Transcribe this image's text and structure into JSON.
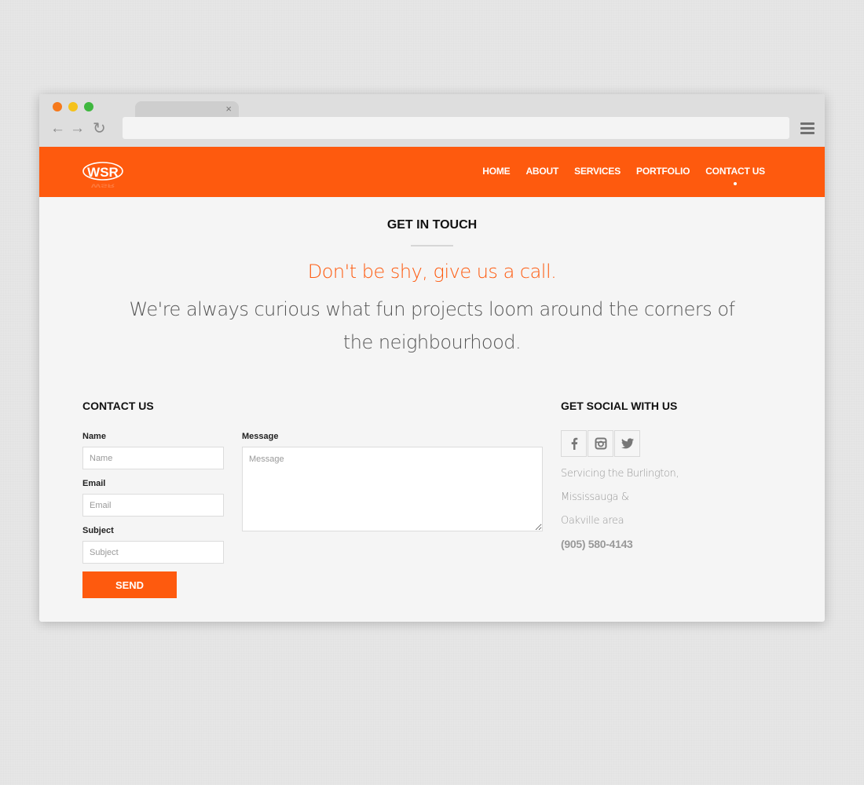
{
  "brand": {
    "logo_text": "WSR",
    "accent_color": "#fe5a0e"
  },
  "nav": {
    "items": [
      {
        "label": "HOME",
        "active": false
      },
      {
        "label": "ABOUT",
        "active": false
      },
      {
        "label": "SERVICES",
        "active": false
      },
      {
        "label": "PORTFOLIO",
        "active": false
      },
      {
        "label": "CONTACT US",
        "active": true
      }
    ]
  },
  "intro": {
    "title": "GET IN TOUCH",
    "tagline": "Don't be shy, give us a call.",
    "description": "We're always curious what fun projects loom around the corners of the neighbourhood."
  },
  "contact": {
    "heading": "CONTACT US",
    "name_label": "Name",
    "name_placeholder": "Name",
    "email_label": "Email",
    "email_placeholder": "Email",
    "subject_label": "Subject",
    "subject_placeholder": "Subject",
    "message_label": "Message",
    "message_placeholder": "Message",
    "send_label": "SEND"
  },
  "social": {
    "heading": "GET SOCIAL WITH US",
    "icons": [
      "facebook-icon",
      "instagram-icon",
      "twitter-icon"
    ],
    "service_lines": [
      "Servicing the Burlington,",
      "Mississauga &",
      "Oakville area"
    ],
    "phone": "(905) 580-4143"
  }
}
